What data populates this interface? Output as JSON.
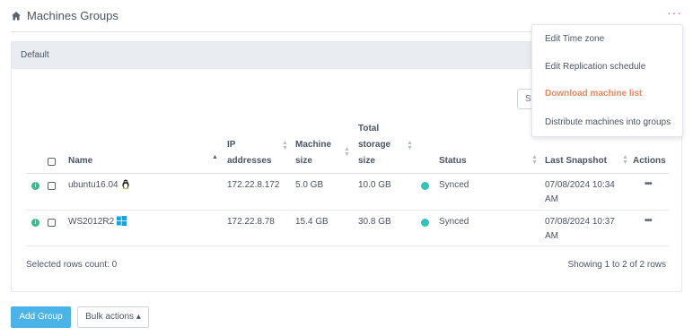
{
  "header": {
    "title": "Machines Groups",
    "menu_label": "···"
  },
  "panel": {
    "title": "Default"
  },
  "search": {
    "placeholder": "Se"
  },
  "table": {
    "columns": {
      "name": "Name",
      "ip_line1": "IP",
      "ip_line2": "addresses",
      "size_line1": "Machine",
      "size_line2": "size",
      "storage_line1": "Total",
      "storage_line2": "storage",
      "storage_line3": "size",
      "status": "Status",
      "snapshot": "Last Snapshot",
      "actions": "Actions"
    },
    "rows": [
      {
        "name": "ubuntu16.04",
        "os_icon": "linux-icon",
        "ip": "172.22.8.172",
        "machine_size": "5.0 GB",
        "storage_size": "10.0 GB",
        "status": "Synced",
        "snapshot_line1": "07/08/2024 10:34",
        "snapshot_line2": "AM",
        "actions": "•••"
      },
      {
        "name": "WS2012R2",
        "os_icon": "windows-icon",
        "ip": "172.22.8.78",
        "machine_size": "15.4 GB",
        "storage_size": "30.8 GB",
        "status": "Synced",
        "snapshot_line1": "07/08/2024 10:37",
        "snapshot_line2": "AM",
        "actions": "•••"
      }
    ]
  },
  "footer": {
    "selected": "Selected rows count: 0",
    "showing": "Showing 1 to 2 of 2 rows"
  },
  "dropdown": {
    "items": [
      {
        "label": "Edit Time zone"
      },
      {
        "label": "Edit Replication schedule"
      },
      {
        "label": "Download machine list"
      },
      {
        "label": "Distribute machines into groups"
      }
    ]
  },
  "buttons": {
    "add_group": "Add Group",
    "bulk_actions": "Bulk actions ▴"
  },
  "colors": {
    "accent": "#4ab3e8",
    "status_synced": "#2ec4b6",
    "info": "#3fb98b",
    "menu_highlight": "#f0855a",
    "kebab": "#e4566a"
  }
}
